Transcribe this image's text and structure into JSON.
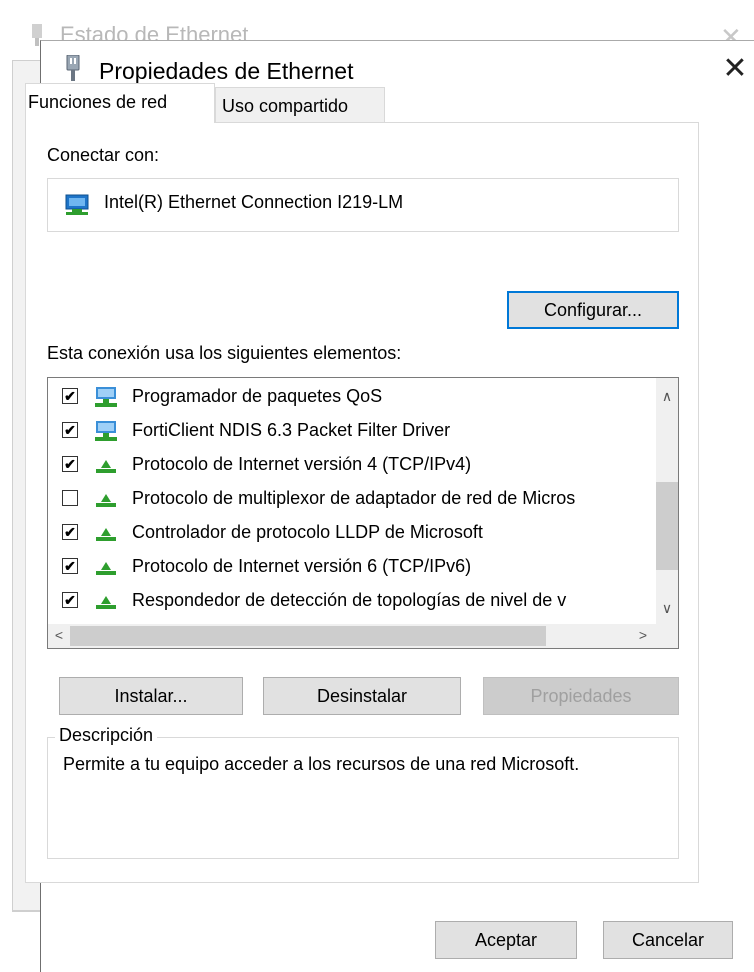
{
  "background_window": {
    "title": "Estado de Ethernet",
    "close_glyph": "✕"
  },
  "dialog": {
    "title": "Propiedades de Ethernet",
    "close_glyph": "✕",
    "tabs": [
      {
        "label": "Funciones de red",
        "active": true
      },
      {
        "label": "Uso compartido",
        "active": false
      }
    ],
    "connect_with_label": "Conectar con:",
    "adapter_name": "Intel(R) Ethernet Connection I219-LM",
    "adapter_icon": "network-adapter-icon",
    "configure_label": "Configurar...",
    "elements_label": "Esta conexión usa los siguientes elementos:",
    "components": [
      {
        "label": "Programador de paquetes QoS",
        "checked": true,
        "icon": "network-service-icon"
      },
      {
        "label": "FortiClient NDIS 6.3 Packet Filter Driver",
        "checked": true,
        "icon": "network-service-icon"
      },
      {
        "label": "Protocolo de Internet versión 4 (TCP/IPv4)",
        "checked": true,
        "icon": "protocol-icon"
      },
      {
        "label": "Protocolo de multiplexor de adaptador de red de Micros",
        "checked": false,
        "icon": "protocol-icon"
      },
      {
        "label": "Controlador de protocolo LLDP de Microsoft",
        "checked": true,
        "icon": "protocol-icon"
      },
      {
        "label": "Protocolo de Internet versión 6 (TCP/IPv6)",
        "checked": true,
        "icon": "protocol-icon"
      },
      {
        "label": "Respondedor de detección de topologías de nivel de v",
        "checked": true,
        "icon": "protocol-icon"
      }
    ],
    "install_label": "Instalar...",
    "uninstall_label": "Desinstalar",
    "properties_label": "Propiedades",
    "description_legend": "Descripción",
    "description_text": "Permite a tu equipo acceder a los recursos de una red Microsoft.",
    "ok_label": "Aceptar",
    "cancel_label": "Cancelar",
    "colors": {
      "focus": "#0078d7",
      "icon_green": "#2e9e2e",
      "icon_blue": "#1e74c8"
    }
  }
}
